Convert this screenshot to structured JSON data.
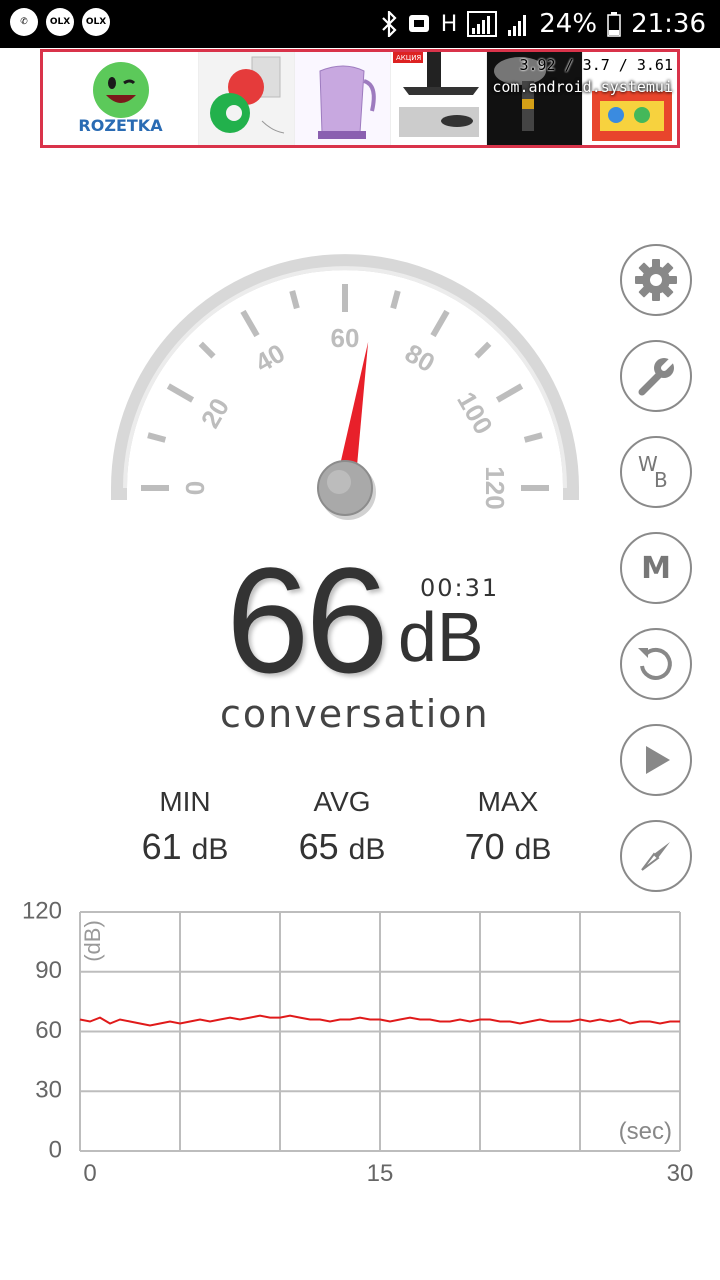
{
  "status_bar": {
    "left_icons": [
      {
        "name": "viber-icon",
        "glyph": "✆"
      },
      {
        "name": "olx-icon",
        "glyph": "OLX"
      },
      {
        "name": "olx-icon-2",
        "glyph": "OLX"
      }
    ],
    "network_type": "H",
    "battery": "24%",
    "time": "21:36"
  },
  "ad_banner": {
    "brand": "ROZETKA",
    "badge": "АКЦИЯ",
    "overlay_stats": "3.92 / 3.7 / 3.61",
    "overlay_package": "com.android.systemui"
  },
  "gauge": {
    "min": 0,
    "max": 120,
    "labels": [
      "0",
      "20",
      "40",
      "60",
      "80",
      "100",
      "120"
    ],
    "value": 66,
    "needle_color": "#e8202a"
  },
  "reading": {
    "value": "66",
    "unit": "dB",
    "timer": "00:31",
    "description": "conversation"
  },
  "stats": [
    {
      "label": "MIN",
      "value": "61",
      "unit": "dB"
    },
    {
      "label": "AVG",
      "value": "65",
      "unit": "dB"
    },
    {
      "label": "MAX",
      "value": "70",
      "unit": "dB"
    }
  ],
  "side_buttons": [
    {
      "name": "settings-button",
      "icon": "gear-icon"
    },
    {
      "name": "tools-button",
      "icon": "wrench-icon"
    },
    {
      "name": "white-balance-button",
      "icon": "wb-icon",
      "w": "W",
      "b": "B"
    },
    {
      "name": "memory-button",
      "icon": "m-icon",
      "label": "M"
    },
    {
      "name": "reset-button",
      "icon": "refresh-icon"
    },
    {
      "name": "play-button",
      "icon": "play-icon"
    },
    {
      "name": "compass-button",
      "icon": "compass-icon"
    }
  ],
  "chart_data": {
    "type": "line",
    "ylabel": "(dB)",
    "xlabel": "(sec)",
    "ylim": [
      0,
      120
    ],
    "xlim": [
      0,
      30
    ],
    "yticks": [
      "120",
      "90",
      "60",
      "30",
      "0"
    ],
    "xticks": [
      "0",
      "15",
      "30"
    ],
    "grid": true,
    "line_color": "#e01a1a",
    "series": [
      {
        "values": [
          66,
          65,
          67,
          64,
          66,
          65,
          64,
          63,
          64,
          65,
          64,
          65,
          66,
          65,
          66,
          67,
          66,
          67,
          68,
          67,
          67,
          68,
          67,
          66,
          66,
          65,
          66,
          66,
          67,
          66,
          66,
          65,
          66,
          67,
          66,
          66,
          65,
          65,
          66,
          65,
          66,
          66,
          65,
          65,
          64,
          65,
          66,
          65,
          65,
          65,
          66,
          65,
          66,
          65,
          66,
          64,
          65,
          65,
          64,
          65,
          65
        ]
      }
    ]
  }
}
